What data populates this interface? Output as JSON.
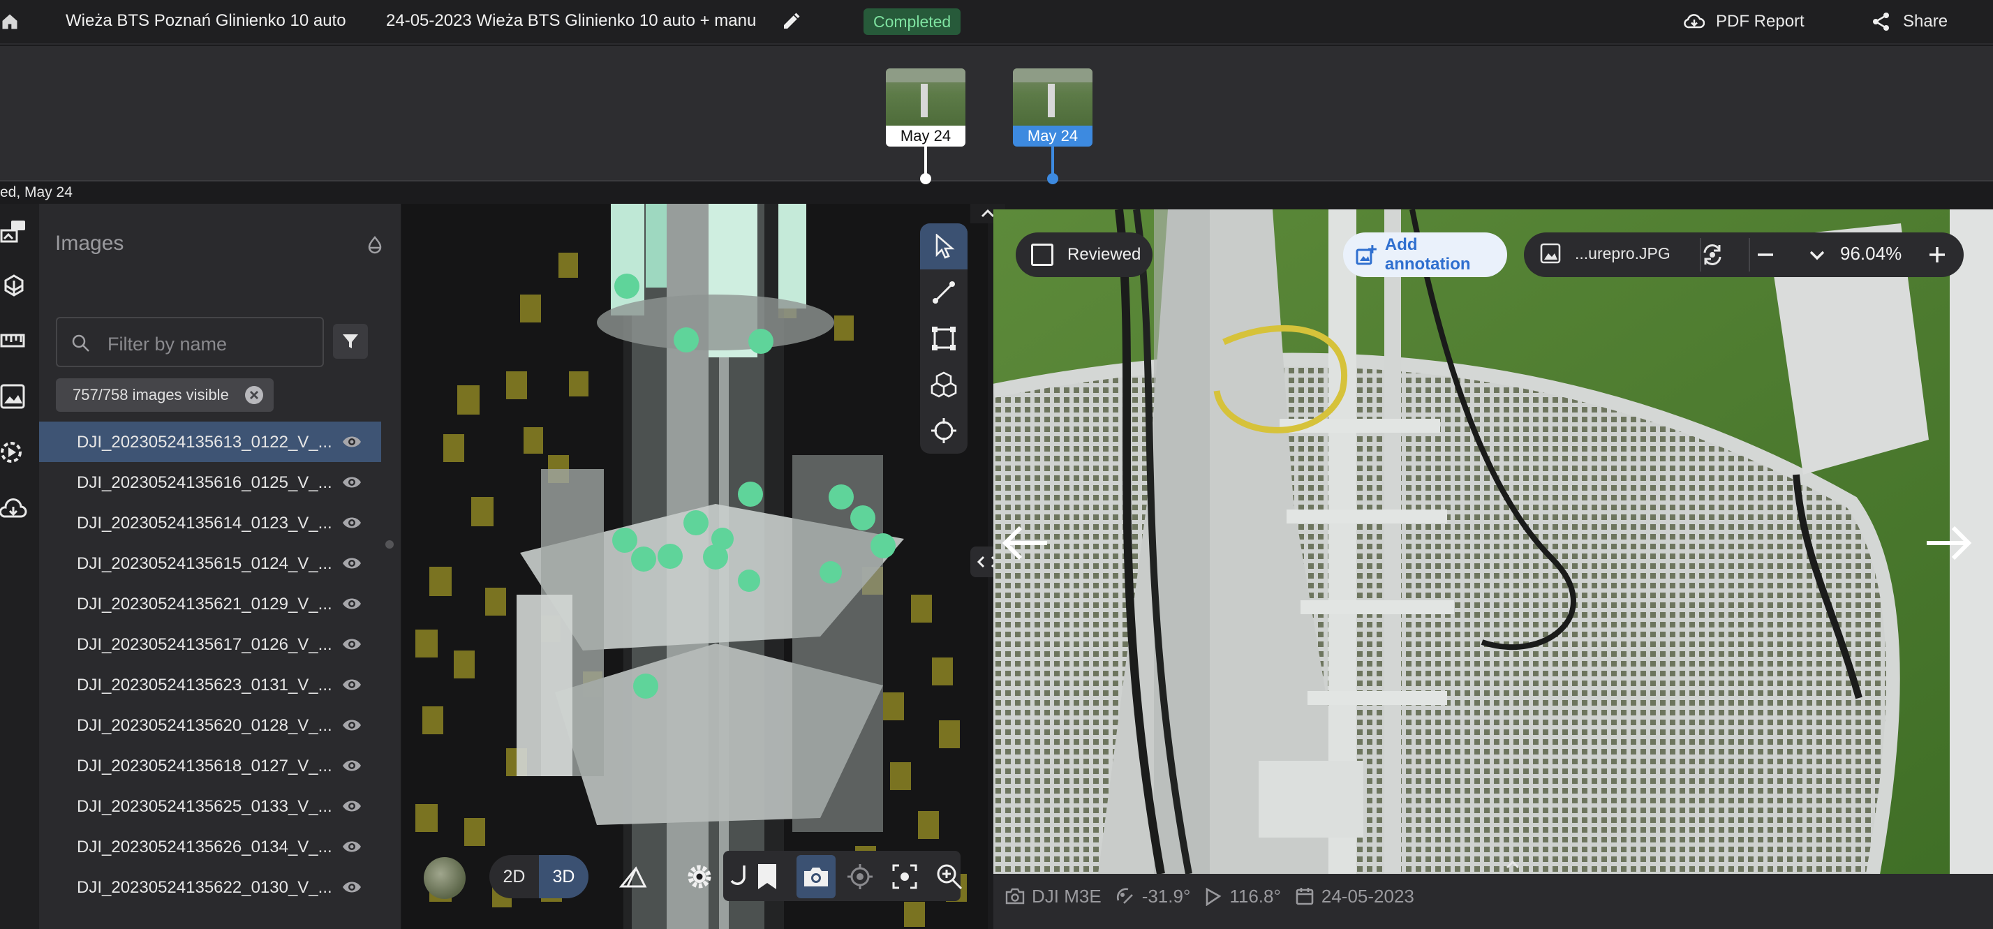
{
  "header": {
    "project_title": "Wieża BTS Poznań Glinienko 10 auto",
    "flight_title": "24-05-2023 Wieża BTS Glinienko 10 auto + manu",
    "status": "Completed",
    "pdf_label": "PDF Report",
    "share_label": "Share",
    "status_color": "#7ee2a0",
    "accent_color": "#3d8ae0"
  },
  "timeline": {
    "items": [
      {
        "label": "May 24",
        "active": false
      },
      {
        "label": "May 24",
        "active": true
      }
    ],
    "caption": "ed, May 24"
  },
  "rail": {
    "icons": [
      "annotation-icon",
      "layers-icon",
      "ruler-icon",
      "images-icon",
      "video-icon",
      "cloud-download-icon"
    ]
  },
  "images_panel": {
    "title": "Images",
    "search_placeholder": "Filter by name",
    "visible_chip": "757/758 images visible",
    "items": [
      "DJI_20230524135613_0122_V_...",
      "DJI_20230524135616_0125_V_...",
      "DJI_20230524135614_0123_V_...",
      "DJI_20230524135615_0124_V_...",
      "DJI_20230524135621_0129_V_...",
      "DJI_20230524135617_0126_V_...",
      "DJI_20230524135623_0131_V_...",
      "DJI_20230524135620_0128_V_...",
      "DJI_20230524135618_0127_V_...",
      "DJI_20230524135625_0133_V_...",
      "DJI_20230524135626_0134_V_...",
      "DJI_20230524135622_0130_V_..."
    ],
    "selected_index": 0
  },
  "viewer3d": {
    "mode_2d": "2D",
    "mode_3d": "3D",
    "active_mode": "3D",
    "tools": [
      "cursor-icon",
      "line-measure-icon",
      "area-measure-icon",
      "volume-icon",
      "target-icon"
    ]
  },
  "image_viewer": {
    "reviewed_label": "Reviewed",
    "add_annotation_label": "Add annotation",
    "file_name": "...urepro.JPG",
    "zoom": "96.04%",
    "camera": "DJI M3E",
    "gimbal_pitch": "-31.9°",
    "heading": "116.8°",
    "date": "24-05-2023"
  }
}
